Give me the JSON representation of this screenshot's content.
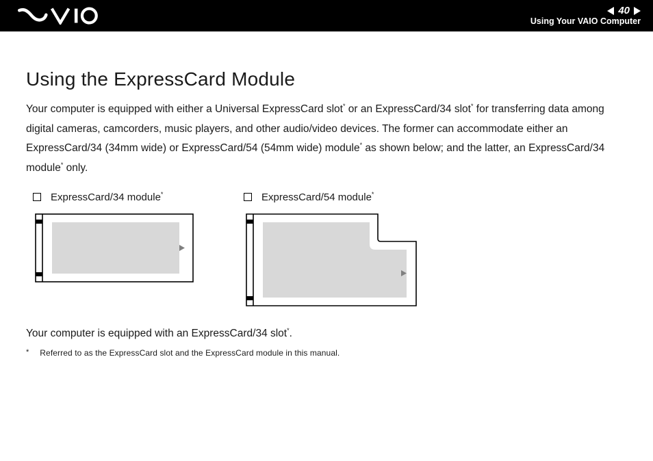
{
  "header": {
    "page_number": "40",
    "section_label": "Using Your VAIO Computer"
  },
  "main": {
    "title": "Using the ExpressCard Module",
    "intro_part1": "Your computer is equipped with either a Universal ExpressCard slot",
    "intro_part2": " or an ExpressCard/34 slot",
    "intro_part3": " for transferring data among digital cameras, camcorders, music players, and other audio/video devices. The former can accommodate either an ExpressCard/34 (34mm wide) or ExpressCard/54 (54mm wide) module",
    "intro_part4": " as shown below; and the latter, an ExpressCard/34 module",
    "intro_part5": " only.",
    "module34_label": "ExpressCard/34 module",
    "module54_label": "ExpressCard/54 module",
    "closing_part1": "Your computer is equipped with an ExpressCard/34 slot",
    "closing_part2": ".",
    "footnote_symbol": "*",
    "footnote_text": "Referred to as the ExpressCard slot and the ExpressCard module in this manual.",
    "asterisk": "*"
  }
}
